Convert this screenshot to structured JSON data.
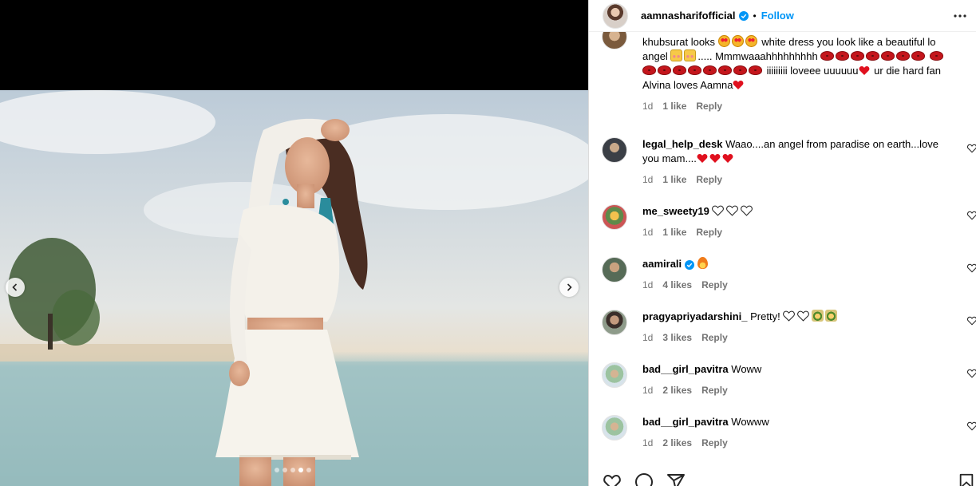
{
  "post": {
    "username": "aamnasharifofficial",
    "separator": "•",
    "follow_label": "Follow",
    "verified": true
  },
  "media": {
    "slide_count": 5,
    "active_slide": 4
  },
  "comments": [
    {
      "user": "",
      "avatar": "avatar-cut-off",
      "text_parts": [
        "khubsurat looks ",
        "white dress you look like a beautiful lo angel ",
        "..... Mmmwaaahhhhhhhhh ",
        " iiiiiiiii loveee uuuuuu",
        " ur die hard fan Alvina loves Aamna"
      ],
      "time": "1d",
      "likes": "1 like",
      "reply": "Reply"
    },
    {
      "user": "legal_help_desk",
      "text": "Waao....an angel from paradise on earth...love you mam....",
      "time": "1d",
      "likes": "1 like",
      "reply": "Reply"
    },
    {
      "user": "me_sweety19",
      "text": "",
      "time": "1d",
      "likes": "1 like",
      "reply": "Reply"
    },
    {
      "user": "aamirali",
      "text": "",
      "time": "1d",
      "likes": "4 likes",
      "reply": "Reply"
    },
    {
      "user": "pragyapriyadarshini_",
      "text": "Pretty!",
      "time": "1d",
      "likes": "3 likes",
      "reply": "Reply"
    },
    {
      "user": "bad__girl_pavitra",
      "text": "Woww",
      "time": "1d",
      "likes": "2 likes",
      "reply": "Reply"
    },
    {
      "user": "bad__girl_pavitra",
      "text": "Wowww",
      "time": "1d",
      "likes": "2 likes",
      "reply": "Reply"
    }
  ],
  "colors": {
    "accent": "#0095f6",
    "muted": "#737373",
    "verified": "#0095f6",
    "heart_red": "#e0101e"
  },
  "icons": [
    "more-icon",
    "verified-icon",
    "chevron-left-icon",
    "chevron-right-icon",
    "heart-icon",
    "comment-icon",
    "share-icon",
    "bookmark-icon"
  ]
}
